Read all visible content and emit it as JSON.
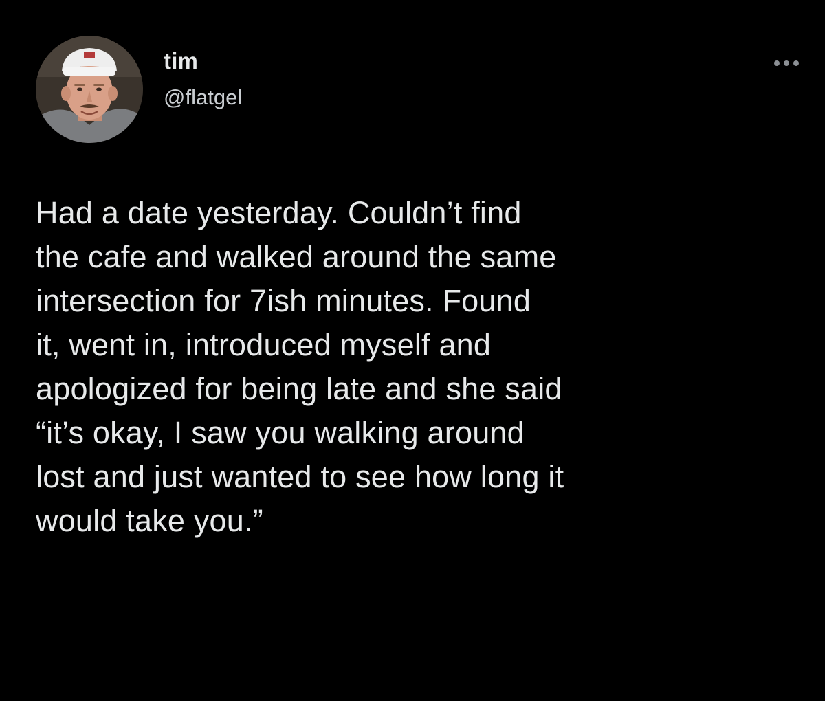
{
  "user": {
    "display_name": "tim",
    "handle": "@flatgel",
    "avatar_icon": "profile-photo"
  },
  "more_icon": "ellipsis-icon",
  "tweet": {
    "lines": [
      "Had a date yesterday. Couldn’t find",
      "the cafe and walked around the same",
      "intersection for 7ish minutes. Found",
      "it, went in, introduced myself and",
      "apologized for being late and she said",
      "“it’s okay, I saw you walking around",
      "lost and just wanted to see how long it",
      "would take you.”"
    ]
  },
  "colors": {
    "background": "#000000",
    "text": "#e7e9ea",
    "secondary_text": "#c9cdd1"
  }
}
